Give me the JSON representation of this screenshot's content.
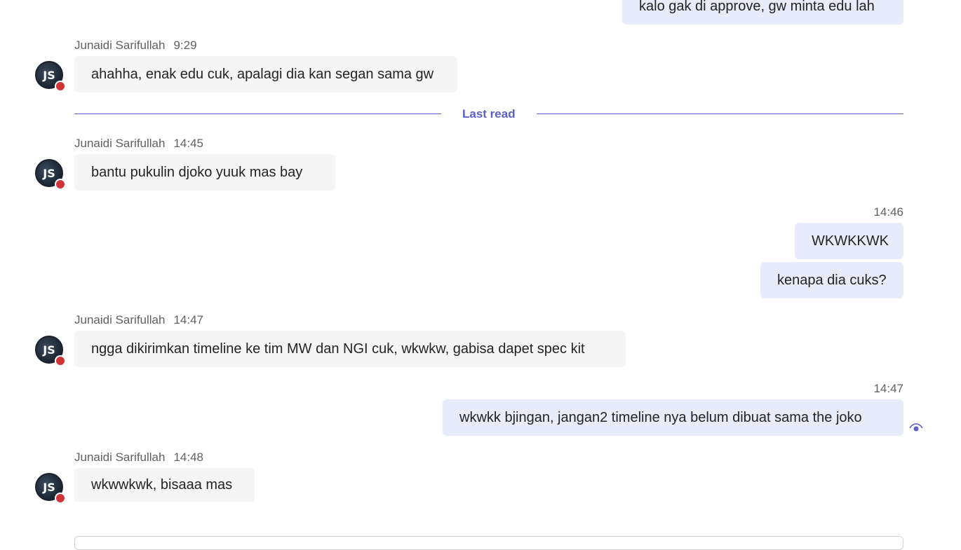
{
  "messages": [
    {
      "id": "m0",
      "direction": "out",
      "text": "kalo gak di approve, gw minta edu lah"
    },
    {
      "id": "m1",
      "direction": "in",
      "sender": "Junaidi Sarifullah",
      "time": "9:29",
      "text": "ahahha, enak edu cuk, apalagi dia kan segan sama gw"
    },
    {
      "id": "m2",
      "direction": "in",
      "sender": "Junaidi Sarifullah",
      "time": "14:45",
      "text": "bantu pukulin djoko yuuk mas bay"
    },
    {
      "id": "m3",
      "direction": "out",
      "time": "14:46",
      "text": "WKWKKWK"
    },
    {
      "id": "m4",
      "direction": "out",
      "text": "kenapa dia cuks?"
    },
    {
      "id": "m5",
      "direction": "in",
      "sender": "Junaidi Sarifullah",
      "time": "14:47",
      "text": "ngga dikirimkan timeline ke tim MW dan NGI cuk, wkwkw, gabisa dapet spec kit"
    },
    {
      "id": "m6",
      "direction": "out",
      "time": "14:47",
      "text": "wkwkk bjingan, jangan2 timeline nya belum dibuat sama the joko"
    },
    {
      "id": "m7",
      "direction": "in",
      "sender": "Junaidi Sarifullah",
      "time": "14:48",
      "text": "wkwwkwk, bisaaa mas"
    }
  ],
  "divider": {
    "label": "Last read"
  },
  "avatar": {
    "initials": "JS",
    "status_color": "#d13438"
  },
  "colors": {
    "accent": "#5b5fc7",
    "bubble_out": "#e8ebfa",
    "bubble_in": "#f5f5f5"
  },
  "icons": {
    "read_receipt": "eye-icon",
    "presence": "busy-status-dot"
  }
}
